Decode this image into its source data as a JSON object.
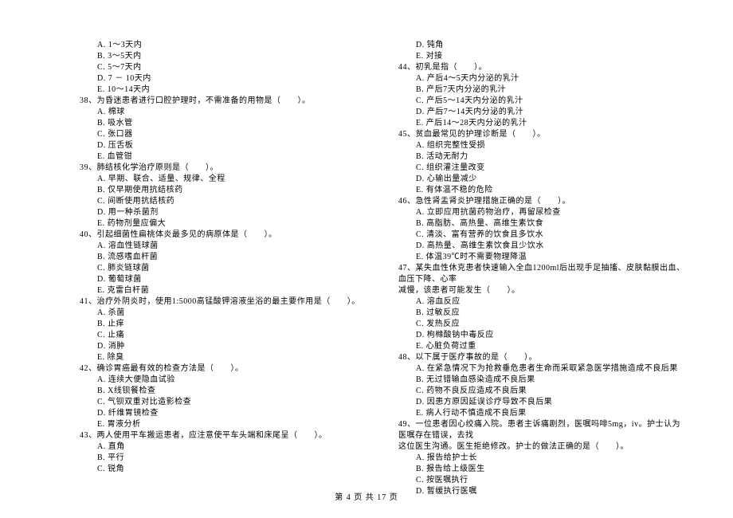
{
  "columns": {
    "left": [
      {
        "type": "option",
        "text": "A. 1～3天内"
      },
      {
        "type": "option",
        "text": "B. 3～5天内"
      },
      {
        "type": "option",
        "text": "C. 5～7天内"
      },
      {
        "type": "option",
        "text": "D. 7 － 10天内"
      },
      {
        "type": "option",
        "text": "E. 10～14天内"
      },
      {
        "type": "question",
        "text": "38、为昏迷患者进行口腔护理时，不需准备的用物是（　　）。"
      },
      {
        "type": "option",
        "text": "A. 棉球"
      },
      {
        "type": "option",
        "text": "B. 吸水管"
      },
      {
        "type": "option",
        "text": "C. 张口器"
      },
      {
        "type": "option",
        "text": "D. 压舌板"
      },
      {
        "type": "option",
        "text": "E. 血管钳"
      },
      {
        "type": "question",
        "text": "39、肺结核化学治疗原则是（　　）。"
      },
      {
        "type": "option",
        "text": "A. 早期、联合、适量、规律、全程"
      },
      {
        "type": "option",
        "text": "B. 仅早期使用抗结核药"
      },
      {
        "type": "option",
        "text": "C. 间断使用抗结核药"
      },
      {
        "type": "option",
        "text": "D. 用一种杀菌剂"
      },
      {
        "type": "option",
        "text": "E. 药物剂量应偏大"
      },
      {
        "type": "question",
        "text": "40、引起细菌性扁桃体炎最多见的病原体是（　　）。"
      },
      {
        "type": "option",
        "text": "A. 溶血性链球菌"
      },
      {
        "type": "option",
        "text": "B. 流感嗜血杆菌"
      },
      {
        "type": "option",
        "text": "C. 肺炎链球菌"
      },
      {
        "type": "option",
        "text": "D. 葡萄球菌"
      },
      {
        "type": "option",
        "text": "E. 克雷白杆菌"
      },
      {
        "type": "question",
        "text": "41、治疗外阴炎时，使用1:5000高锰酸钾溶液坐浴的最主要作用是（　　）。"
      },
      {
        "type": "option",
        "text": "A. 杀菌"
      },
      {
        "type": "option",
        "text": "B. 止痒"
      },
      {
        "type": "option",
        "text": "C. 止痛"
      },
      {
        "type": "option",
        "text": "D. 消肿"
      },
      {
        "type": "option",
        "text": "E. 除臭"
      },
      {
        "type": "question",
        "text": "42、确诊胃癌最有效的检查方法是（　　）。"
      },
      {
        "type": "option",
        "text": "A. 连续大便隐血试验"
      },
      {
        "type": "option",
        "text": "B. X线钡餐检查"
      },
      {
        "type": "option",
        "text": "C. 气钡双重对比造影检查"
      },
      {
        "type": "option",
        "text": "D. 纤维胃镜检查"
      },
      {
        "type": "option",
        "text": "E. 胃液分析"
      },
      {
        "type": "question",
        "text": "43、两人使用平车搬运患者，应注意使平车头端和床尾呈（　　）。"
      },
      {
        "type": "option",
        "text": "A. 直角"
      },
      {
        "type": "option",
        "text": "B. 平行"
      },
      {
        "type": "option",
        "text": "C. 锐角"
      }
    ],
    "right": [
      {
        "type": "option",
        "text": "D. 钝角"
      },
      {
        "type": "option",
        "text": "E. 对接"
      },
      {
        "type": "question",
        "text": "44、初乳是指（　　）。"
      },
      {
        "type": "option",
        "text": "A. 产后4～5天内分泌的乳汁"
      },
      {
        "type": "option",
        "text": "B. 产后7天内分泌的乳汁"
      },
      {
        "type": "option",
        "text": "C. 产后5～14天内分泌的乳汁"
      },
      {
        "type": "option",
        "text": "D. 产后7～14天内分泌的乳汁"
      },
      {
        "type": "option",
        "text": "E. 产后14～28天内分泌的乳汁"
      },
      {
        "type": "question",
        "text": "45、贫血最常见的护理诊断是（　　）。"
      },
      {
        "type": "option",
        "text": "A. 组织完整性受损"
      },
      {
        "type": "option",
        "text": "B. 活动无耐力"
      },
      {
        "type": "option",
        "text": "C. 组织灌注量改变"
      },
      {
        "type": "option",
        "text": "D. 心输出量减少"
      },
      {
        "type": "option",
        "text": "E. 有体温不稳的危险"
      },
      {
        "type": "question",
        "text": "46、急性肾盂肾炎护理措施正确的是（　　）。"
      },
      {
        "type": "option",
        "text": "A. 立即应用抗菌药物治疗，再留尿检查"
      },
      {
        "type": "option",
        "text": "B. 高脂肪、高热量、高维生素饮食"
      },
      {
        "type": "option",
        "text": "C. 清淡、富有营养的饮食且多饮水"
      },
      {
        "type": "option",
        "text": "D. 高热量、高维生素饮食且少饮水"
      },
      {
        "type": "option",
        "text": "E. 体温39℃时不需要物理降温"
      },
      {
        "type": "question",
        "text": "47、某失血性休克患者快速输入全血1200ml后出现手足抽搐、皮肤黏膜出血、血压下降、心率"
      },
      {
        "type": "question-continuation",
        "text": "减慢，该患者可能发生（　　）。"
      },
      {
        "type": "option",
        "text": "A. 溶血反应"
      },
      {
        "type": "option",
        "text": "B. 过敏反应"
      },
      {
        "type": "option",
        "text": "C. 发热反应"
      },
      {
        "type": "option",
        "text": "D. 枸橼酸钠中毒反应"
      },
      {
        "type": "option",
        "text": "E. 心脏负荷过重"
      },
      {
        "type": "question",
        "text": "48、以下属于医疗事故的是（　　）。"
      },
      {
        "type": "option",
        "text": "A. 在紧急情况下为抢救垂危患者生命而采取紧急医学措施造成不良后果"
      },
      {
        "type": "option",
        "text": "B. 无过错输血感染造成不良后果"
      },
      {
        "type": "option",
        "text": "C. 药物不良反应造成不良后果"
      },
      {
        "type": "option",
        "text": "D. 因患方原因延误诊疗导致不良后果"
      },
      {
        "type": "option",
        "text": "E. 病人行动不慎造成不良后果"
      },
      {
        "type": "question",
        "text": "49、一位患者因心绞痛入院。患者主诉痛剧烈，医嘱吗啡5mg，iv。护士认为医嘱存在错误，去找"
      },
      {
        "type": "question-continuation",
        "text": "这位医生沟通。医生拒绝修改。护士的做法正确的是（　　）。"
      },
      {
        "type": "option",
        "text": "A. 报告给护士长"
      },
      {
        "type": "option",
        "text": "B. 报告给上级医生"
      },
      {
        "type": "option",
        "text": "C. 按医嘱执行"
      },
      {
        "type": "option",
        "text": "D. 暂缓执行医嘱"
      }
    ]
  },
  "footer": {
    "text": "第 4 页 共 17 页"
  }
}
